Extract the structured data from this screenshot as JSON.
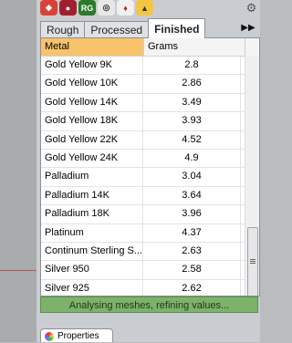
{
  "toolbar": {
    "icons": [
      "bag-icon",
      "ruby-icon",
      "rg-icon",
      "compass-icon",
      "gem-ring-icon",
      "lamp-icon",
      "settings-icon"
    ],
    "rg_label": "RG"
  },
  "tabs": [
    {
      "label": "Rough",
      "active": false
    },
    {
      "label": "Processed",
      "active": false
    },
    {
      "label": "Finished",
      "active": true
    }
  ],
  "table": {
    "headers": {
      "metal": "Metal",
      "grams": "Grams"
    },
    "rows": [
      {
        "metal": "Gold Yellow 9K",
        "grams": "2.8"
      },
      {
        "metal": "Gold Yellow 10K",
        "grams": "2.86"
      },
      {
        "metal": "Gold Yellow 14K",
        "grams": "3.49"
      },
      {
        "metal": "Gold Yellow 18K",
        "grams": "3.93"
      },
      {
        "metal": "Gold Yellow 22K",
        "grams": "4.52"
      },
      {
        "metal": "Gold Yellow 24K",
        "grams": "4.9"
      },
      {
        "metal": "Palladium",
        "grams": "3.04"
      },
      {
        "metal": "Palladium 14K",
        "grams": "3.64"
      },
      {
        "metal": "Palladium 18K",
        "grams": "3.96"
      },
      {
        "metal": "Platinum",
        "grams": "4.37"
      },
      {
        "metal": "Continum Sterling S...",
        "grams": "2.63"
      },
      {
        "metal": "Silver 950",
        "grams": "2.58"
      },
      {
        "metal": "Silver 925",
        "grams": "2.62"
      }
    ]
  },
  "status": {
    "text": "Analysing meshes, refining values..."
  },
  "bottom_tab": {
    "label": "Properties"
  },
  "colors": {
    "header_highlight": "#f8c36b",
    "status_bg": "#7db26a"
  }
}
